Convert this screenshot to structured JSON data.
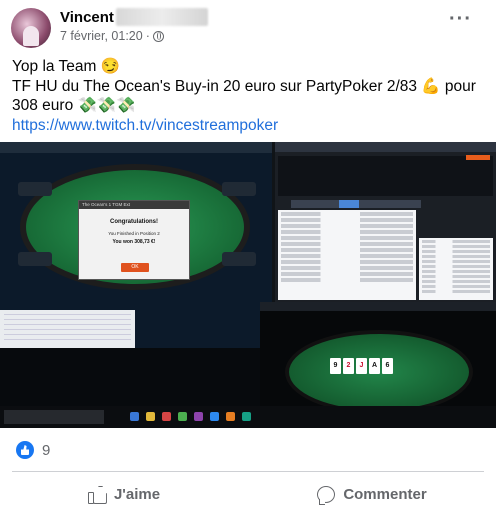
{
  "post": {
    "author": "Vincent",
    "timestamp": "7 février, 01:20",
    "visibility_icon": "globe-icon",
    "more_icon": "ellipsis-icon",
    "text_line1": "Yop la Team 😏",
    "text_line2": "TF HU du The Ocean's Buy-in 20 euro sur PartyPoker 2/83 💪 pour 308 euro 💸💸💸",
    "link": "https://www.twitch.tv/vincestreampoker"
  },
  "screenshot": {
    "dialog_title": "The Ocean's 1 TGM Ext",
    "dialog_heading": "Congratulations!",
    "dialog_position": "You Finished in Position 2",
    "dialog_win": "You won 308,73 €!",
    "dialog_ok": "OK",
    "board_cards": [
      "9",
      "2",
      "J",
      "A",
      "6"
    ]
  },
  "reactions": {
    "like_icon": "like-reaction-icon",
    "count": "9"
  },
  "actions": {
    "like_label": "J'aime",
    "comment_label": "Commenter"
  },
  "colors": {
    "link": "#216fdb",
    "like_blue": "#1877f2",
    "muted": "#65676b"
  }
}
